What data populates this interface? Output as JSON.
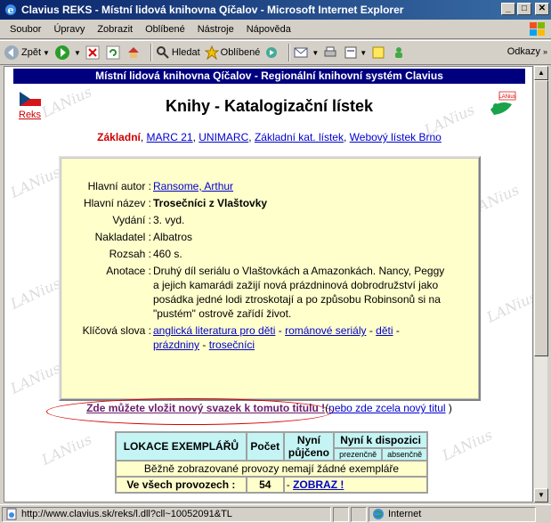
{
  "window": {
    "title": "Clavius REKS - Místní lidová knihovna Qíčalov - Microsoft Internet Explorer"
  },
  "menu": [
    "Soubor",
    "Úpravy",
    "Zobrazit",
    "Oblíbené",
    "Nástroje",
    "Nápověda"
  ],
  "toolbar": {
    "back": "Zpět",
    "search": "Hledat",
    "favorites": "Oblíbené",
    "links": "Odkazy"
  },
  "page": {
    "banner": "Místní lidová knihovna Qíčalov - Regionální knihovní systém Clavius",
    "flag_link": "Reks",
    "lanius_logo": "LANius",
    "title": "Knihy - Katalogizační lístek",
    "nav": {
      "active": "Základní",
      "links": [
        "MARC 21",
        "UNIMARC",
        "Základní kat. lístek",
        "Webový lístek Brno"
      ],
      "sep": ","
    },
    "record": {
      "author_label": "Hlavní autor :",
      "author": "Ransome, Arthur",
      "title_label": "Hlavní název :",
      "title": "Trosečníci z Vlaštovky",
      "edition_label": "Vydání :",
      "edition": "3. vyd.",
      "publisher_label": "Nakladatel :",
      "publisher": "Albatros",
      "year_label": "Rozsah :",
      "year": "460 s.",
      "annotation_label": "Anotace :",
      "annotation": "Druhý díl seriálu o Vlaštovkách a Amazonkách. Nancy, Peggy a jejich kamarádi zažijí nová prázdninová dobrodružství jako posádka jedné lodi ztroskotají a po způsobu Robinsonů si na \"pustém\" ostrově zařídí život.",
      "keywords_label": "Klíčová slova :",
      "keywords": [
        "anglická literatura pro děti",
        "románové seriály",
        "děti",
        "prázdniny",
        "trosečníci"
      ],
      "kw_sep": "-"
    },
    "action": {
      "new_volume": "Zde můžete vložit nový svazek k tomuto titulu !",
      "open_paren": "(",
      "new_title": "nebo zde zcela nový titul",
      "close_paren": ")"
    },
    "copies": {
      "col_location": "LOKACE EXEMPLÁŘŮ",
      "col_count": "Počet",
      "col_loaned_1": "Nyní",
      "col_loaned_2": "půjčeno",
      "col_available": "Nyní k dispozici",
      "sub_present": "prezenčně",
      "sub_absent": "absenčně",
      "empty_msg": "Běžně zobrazované provozy nemají žádné exempláře",
      "all_label": "Ve všech provozech :",
      "all_count": "54",
      "show_prefix": "-",
      "show_link": "ZOBRAZ !"
    },
    "watermark": "LANius"
  },
  "status": {
    "url": "http://www.clavius.sk/reks/l.dll?cll~10052091&TL",
    "zone": "Internet"
  }
}
